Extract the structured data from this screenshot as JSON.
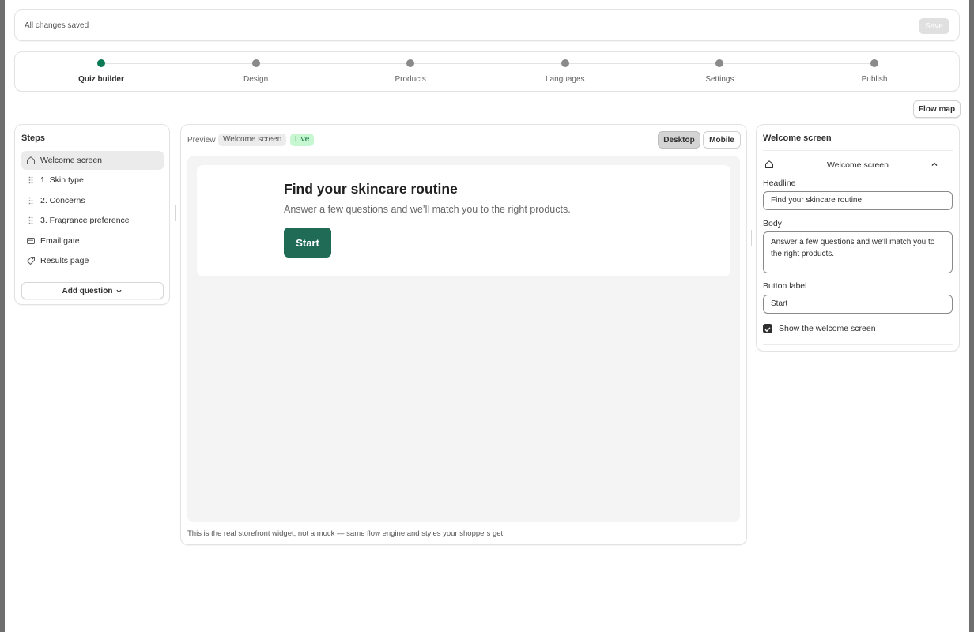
{
  "save_bar": {
    "status": "All changes saved",
    "save_label": "Save"
  },
  "stepper": {
    "steps": [
      "Quiz builder",
      "Design",
      "Products",
      "Languages",
      "Settings",
      "Publish"
    ],
    "active": "Quiz builder"
  },
  "flow_map_label": "Flow map",
  "steps_panel": {
    "title": "Steps",
    "items": [
      {
        "label": "Welcome screen",
        "icon": "home-icon",
        "selected": true
      },
      {
        "label": "1. Skin type",
        "icon": "drag-handle-icon"
      },
      {
        "label": "2. Concerns",
        "icon": "drag-handle-icon"
      },
      {
        "label": "3. Fragrance preference",
        "icon": "drag-handle-icon"
      },
      {
        "label": "Email gate",
        "icon": "email-icon"
      },
      {
        "label": "Results page",
        "icon": "tag-icon"
      }
    ],
    "add_question": "Add question"
  },
  "preview": {
    "label": "Preview",
    "screen_chip": "Welcome screen",
    "live_chip": "Live",
    "desktop_label": "Desktop",
    "mobile_label": "Mobile",
    "widget": {
      "headline": "Find your skincare routine",
      "body": "Answer a few questions and we’ll match you to the right products.",
      "button": "Start"
    },
    "note": "This is the real storefront widget, not a mock — same flow engine and styles your shoppers get."
  },
  "settings_panel": {
    "title": "Welcome screen",
    "section_title": "Welcome screen",
    "headline_label": "Headline",
    "headline_value": "Find your skincare routine",
    "body_label": "Body",
    "body_value": "Answer a few questions and we’ll match you to the right products.",
    "button_label_label": "Button label",
    "button_label_value": "Start",
    "show_welcome_label": "Show the welcome screen",
    "show_welcome_checked": true
  },
  "colors": {
    "accent": "#0b7a55",
    "start_button": "#1f6b56",
    "live_chip": "#c7f7d0"
  }
}
